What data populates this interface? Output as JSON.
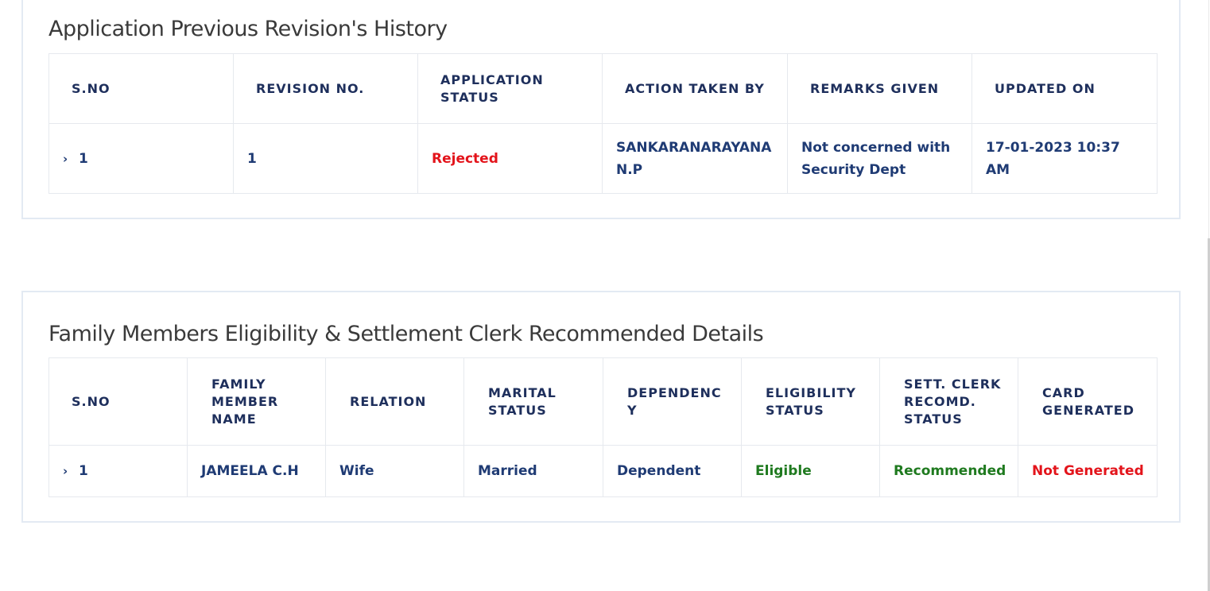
{
  "revision_history": {
    "title": "Application Previous Revision's History",
    "columns": [
      "S.NO",
      "REVISION NO.",
      "APPLICATION STATUS",
      "ACTION TAKEN BY",
      "REMARKS GIVEN",
      "UPDATED ON"
    ],
    "rows": [
      {
        "sno": "1",
        "revision_no": "1",
        "application_status": "Rejected",
        "action_taken_by": "SANKARANARAYANAN.P",
        "remarks_given": "Not concerned with Security Dept",
        "updated_on": "17-01-2023 10:37 AM"
      }
    ]
  },
  "family_members": {
    "title": "Family Members Eligibility & Settlement Clerk Recommended Details",
    "columns": [
      "S.NO",
      "FAMILY MEMBER NAME",
      "RELATION",
      "MARITAL STATUS",
      "DEPENDENCY",
      "ELIGIBILITY STATUS",
      "SETT. CLERK RECOMD. STATUS",
      "CARD GENERATED"
    ],
    "rows": [
      {
        "sno": "1",
        "member_name": "JAMEELA C.H",
        "relation": "Wife",
        "marital_status": "Married",
        "dependency": "Dependent",
        "eligibility_status": "Eligible",
        "clerk_recommendation": "Recommended",
        "card_generated": "Not Generated"
      }
    ]
  },
  "icons": {
    "row_expand": "chevron-right-icon"
  },
  "colors": {
    "header_text": "#1e2f5c",
    "cell_text": "#1f3b74",
    "rejected": "#e3141b",
    "eligible": "#1f7a1f",
    "not_generated": "#e3141b",
    "panel_border": "#e3eaf3"
  }
}
